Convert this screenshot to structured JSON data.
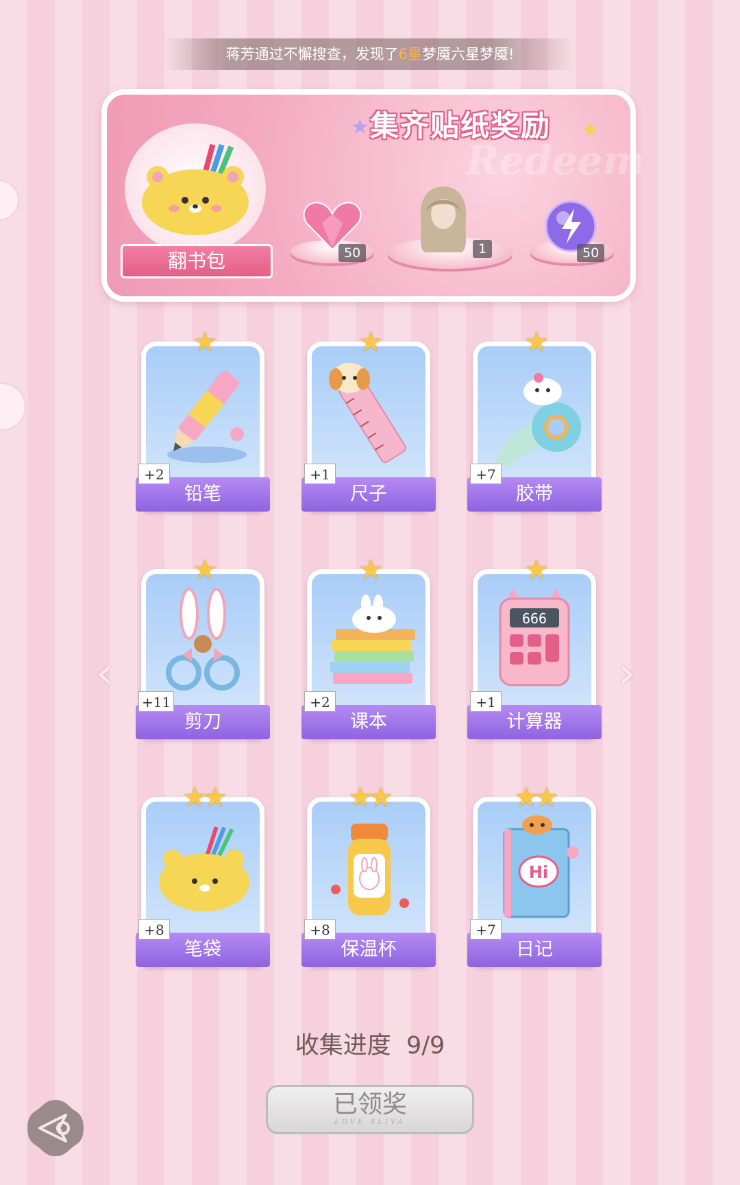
{
  "ticker": {
    "prefix": "蒋芳通过不懈搜查，发现了",
    "highlight": "6星",
    "suffix": "梦魇六星梦魇!"
  },
  "banner": {
    "title": "集齐贴纸奖励",
    "watermark": "Redeem",
    "featured_item": "翻书包",
    "rewards": [
      {
        "icon": "pink-heart-gem-icon",
        "count": "50"
      },
      {
        "icon": "hairstyle-icon",
        "count": "1"
      },
      {
        "icon": "purple-orb-icon",
        "count": "50"
      }
    ]
  },
  "stickers": [
    {
      "name": "铅笔",
      "count": "+2",
      "stars": "★",
      "icon": "pencil-icon"
    },
    {
      "name": "尺子",
      "count": "+1",
      "stars": "★",
      "icon": "ruler-icon"
    },
    {
      "name": "胶带",
      "count": "+7",
      "stars": "★",
      "icon": "tape-icon"
    },
    {
      "name": "剪刀",
      "count": "+11",
      "stars": "★",
      "icon": "scissors-icon"
    },
    {
      "name": "课本",
      "count": "+2",
      "stars": "★",
      "icon": "textbook-icon"
    },
    {
      "name": "计算器",
      "count": "+1",
      "stars": "★",
      "icon": "calculator-icon"
    },
    {
      "name": "笔袋",
      "count": "+8",
      "stars": "★★",
      "icon": "pencil-case-icon"
    },
    {
      "name": "保温杯",
      "count": "+8",
      "stars": "★★",
      "icon": "thermos-icon"
    },
    {
      "name": "日记",
      "count": "+7",
      "stars": "★★",
      "icon": "diary-icon"
    }
  ],
  "calculator_display": "666",
  "diary_text": "Hi",
  "progress": {
    "label": "收集进度",
    "value": "9/9"
  },
  "claim_button": {
    "label": "已领奖",
    "sub": "LOVE SLIVA"
  },
  "colors": {
    "label_purple": "#9a6ee6",
    "card_blue": "#a9cdf8",
    "banner_pink": "#f4aac0",
    "star_gold": "#f7c84a"
  }
}
